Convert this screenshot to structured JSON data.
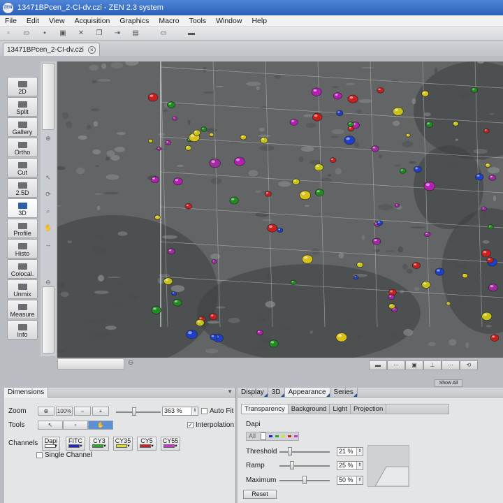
{
  "window": {
    "title": "13471BPcen_2-CI-dv.czi - ZEN 2.3 system",
    "logo_text": "ZEN"
  },
  "menu": [
    "File",
    "Edit",
    "View",
    "Acquisition",
    "Graphics",
    "Macro",
    "Tools",
    "Window",
    "Help"
  ],
  "document_tab": {
    "label": "13471BPcen_2-CI-dv.czi",
    "close_glyph": "×"
  },
  "view_buttons": [
    {
      "label": "2D",
      "icon": "monitor-icon"
    },
    {
      "label": "Split",
      "icon": "split-grid-icon"
    },
    {
      "label": "Gallery",
      "icon": "gallery-grid-icon"
    },
    {
      "label": "Ortho",
      "icon": "ortho-icon"
    },
    {
      "label": "Cut",
      "icon": "cut-layers-icon"
    },
    {
      "label": "2.5D",
      "icon": "surface-icon"
    },
    {
      "label": "3D",
      "icon": "cube-3d-icon",
      "active": true
    },
    {
      "label": "Profile",
      "icon": "profile-icon"
    },
    {
      "label": "Histo",
      "icon": "histogram-icon"
    },
    {
      "label": "Colocal.",
      "icon": "colocalization-icon"
    },
    {
      "label": "Unmix",
      "icon": "unmix-icon"
    },
    {
      "label": "Measure",
      "icon": "measure-icon"
    },
    {
      "label": "Info",
      "icon": "info-icon"
    }
  ],
  "viewer_toolbar": {
    "show_all": "Show All"
  },
  "dimensions": {
    "tab": "Dimensions",
    "zoom_label": "Zoom",
    "zoom_fit": "100%",
    "zoom_value": "363 %",
    "zoom_slider": 0.4,
    "auto_fit": "Auto Fit",
    "tools_label": "Tools",
    "interpolation": "Interpolation",
    "channels_label": "Channels",
    "channels": [
      {
        "name": "Dapi",
        "color": "#ffffff"
      },
      {
        "name": "FITC",
        "color": "#2222cc"
      },
      {
        "name": "CY3",
        "color": "#22aa22"
      },
      {
        "name": "CY35",
        "color": "#dddd22"
      },
      {
        "name": "CY5",
        "color": "#cc2222"
      },
      {
        "name": "CY55",
        "color": "#cc33cc"
      }
    ],
    "single_channel": "Single Channel"
  },
  "appearance": {
    "tabs": [
      "Display",
      "3D",
      "Appearance",
      "Series"
    ],
    "active_tab": "Appearance",
    "subtabs": [
      "Transparency",
      "Background",
      "Light",
      "Projection"
    ],
    "active_subtab": "Transparency",
    "channel_name": "Dapi",
    "all_label": "All",
    "threshold_label": "Threshold",
    "threshold_value": "21 %",
    "threshold": 0.21,
    "ramp_label": "Ramp",
    "ramp_value": "25 %",
    "ramp": 0.25,
    "maximum_label": "Maximum",
    "maximum_value": "50 %",
    "maximum": 0.5,
    "reset_label": "Reset"
  }
}
